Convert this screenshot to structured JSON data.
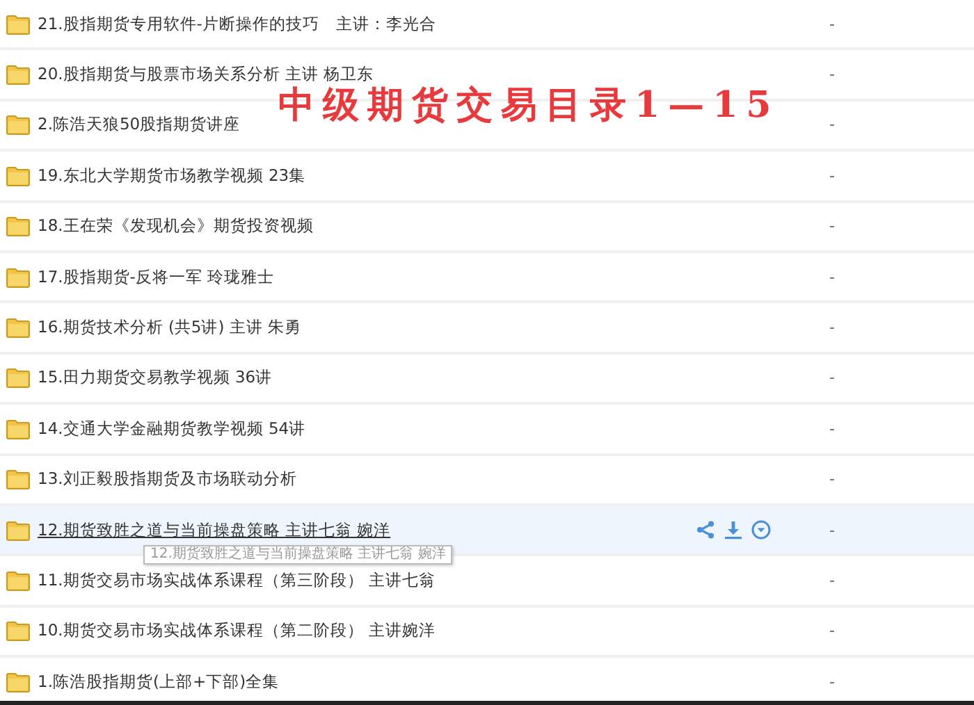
{
  "overlay_title": "中级期货交易目录1—15",
  "files": [
    {
      "name": "21.股指期货专用软件-片断操作的技巧　主讲：李光合",
      "size": "-",
      "hovered": false
    },
    {
      "name": "20.股指期货与股票市场关系分析 主讲 杨卫东",
      "size": "-",
      "hovered": false
    },
    {
      "name": "2.陈浩天狼50股指期货讲座",
      "size": "-",
      "hovered": false
    },
    {
      "name": "19.东北大学期货市场教学视频 23集",
      "size": "-",
      "hovered": false
    },
    {
      "name": "18.王在荣《发现机会》期货投资视频",
      "size": "-",
      "hovered": false
    },
    {
      "name": "17.股指期货-反将一军 玲珑雅士",
      "size": "-",
      "hovered": false
    },
    {
      "name": "16.期货技术分析 (共5讲) 主讲 朱勇",
      "size": "-",
      "hovered": false
    },
    {
      "name": "15.田力期货交易教学视频 36讲",
      "size": "-",
      "hovered": false
    },
    {
      "name": "14.交通大学金融期货教学视频 54讲",
      "size": "-",
      "hovered": false
    },
    {
      "name": "13.刘正毅股指期货及市场联动分析",
      "size": "-",
      "hovered": false
    },
    {
      "name": "12.期货致胜之道与当前操盘策略 主讲七翁 婉洋",
      "size": "-",
      "hovered": true
    },
    {
      "name": "11.期货交易市场实战体系课程（第三阶段） 主讲七翁",
      "size": "-",
      "hovered": false
    },
    {
      "name": "10.期货交易市场实战体系课程（第二阶段） 主讲婉洋",
      "size": "-",
      "hovered": false
    },
    {
      "name": "1.陈浩股指期货(上部+下部)全集",
      "size": "-",
      "hovered": false
    }
  ],
  "tooltip": "12.期货致胜之道与当前操盘策略 主讲七翁 婉洋"
}
